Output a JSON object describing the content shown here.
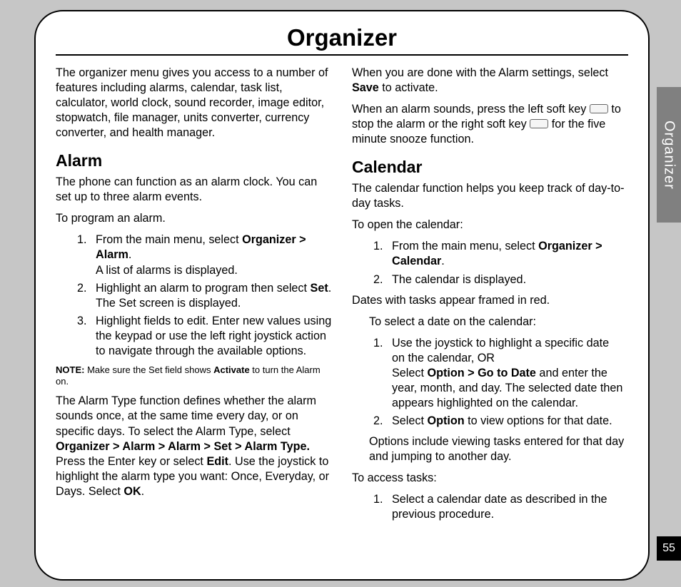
{
  "title": "Organizer",
  "sideTab": "Organizer",
  "pageNumber": "55",
  "left": {
    "intro": "The organizer menu gives you access to a number of features including alarms, calendar, task list, calculator, world clock, sound recorder, image editor, stopwatch, file manager, units converter, currency converter, and health manager.",
    "alarmHeading": "Alarm",
    "alarmP1": "The phone can function as an alarm clock. You can set up to three alarm events.",
    "alarmP2": "To program an alarm.",
    "step1a": "From the main menu, select ",
    "step1b": "Organizer > Alarm",
    "step1c": ".",
    "step1d": "A list of alarms is displayed.",
    "step2a": "Highlight an alarm to program then select ",
    "step2b": "Set",
    "step2c": ".",
    "step2d": "The Set screen is displayed.",
    "step3": "Highlight fields to edit. Enter new values using the keypad or use the left right joystick action to navigate through the available options.",
    "noteL": "NOTE:",
    "noteA": " Make sure the Set field shows ",
    "noteB": "Activate",
    "noteC": " to turn the Alarm on.",
    "typeA": "The Alarm Type function defines whether the alarm sounds once, at the same time every day, or on specific days. To select the Alarm Type, select ",
    "typeB": "Organizer > Alarm > Alarm > Set > Alarm Type.",
    "typeC": " Press the Enter key or select ",
    "typeD": "Edit",
    "typeE": ". Use the joystick to highlight the alarm type you want: Once, Everyday, or Days. Select ",
    "typeF": "OK",
    "typeG": "."
  },
  "right": {
    "saveA": "When you are done with the Alarm settings, select ",
    "saveB": "Save",
    "saveC": " to activate.",
    "sndA": "When an alarm sounds, press the left soft key ",
    "sndB": " to stop the alarm or the right soft key ",
    "sndC": " for the five minute snooze function.",
    "calHeading": "Calendar",
    "calP1": "The calendar function helps you keep track of day-to-day tasks.",
    "calP2": "To open the calendar:",
    "cstep1a": "From the main menu, select ",
    "cstep1b": "Organizer > Calendar",
    "cstep1c": ".",
    "cstep2": "The calendar is displayed.",
    "datesP": "Dates with tasks appear framed in red.",
    "selDateIntro": "To select a date on the calendar:",
    "d1a": "Use the joystick to highlight a specific date",
    "d1b": "on the calendar, OR",
    "d1c": "Select ",
    "d1d": "Option > Go to Date",
    "d1e": " and enter the year, month, and day. The selected date then appears highlighted on the calendar.",
    "d2a": "Select ",
    "d2b": "Option",
    "d2c": " to view options for that date.",
    "optP": "Options include viewing tasks entered for that day and jumping to another day.",
    "accP": "To access tasks:",
    "t1": "Select a calendar date as described in the previous procedure."
  }
}
